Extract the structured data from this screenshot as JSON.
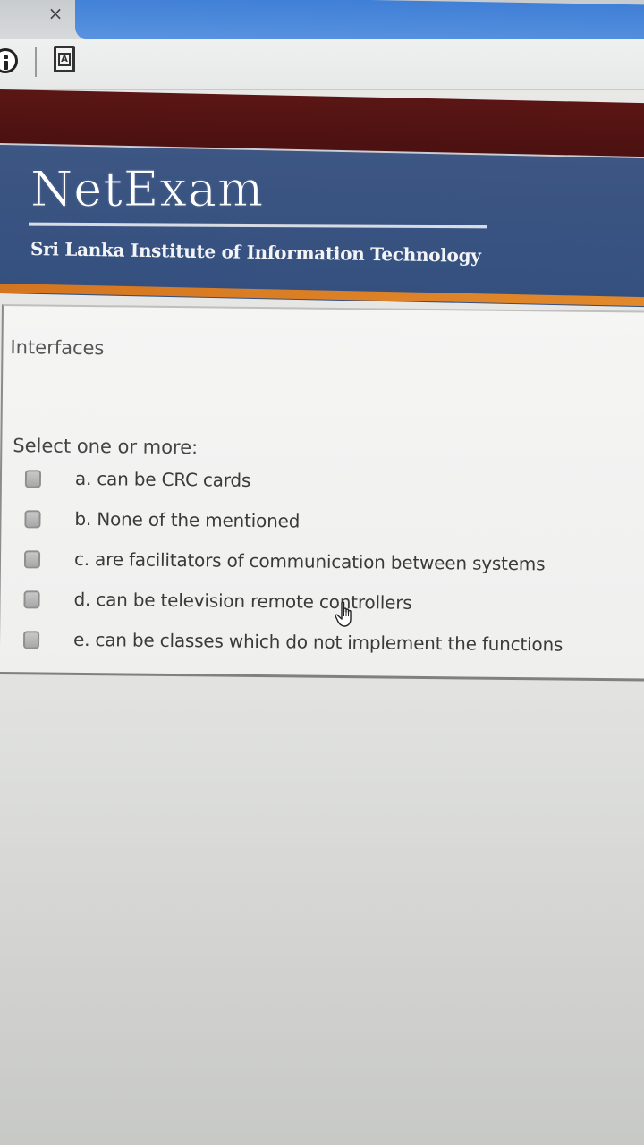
{
  "browser": {
    "close_tab_glyph": "×",
    "icons": [
      "info-icon",
      "page-icon"
    ],
    "page_icon_letter": "A"
  },
  "site": {
    "logo": "NetExam",
    "tagline": "Sri Lanka Institute of Information Technology",
    "colors": {
      "header": "#3d5683",
      "top_band": "#5a1614",
      "accent": "#e38a2d"
    }
  },
  "question": {
    "title": "Interfaces",
    "prompt": "Select one or more:",
    "options": [
      {
        "label": "a. can be CRC cards",
        "checked": false
      },
      {
        "label": "b. None of the mentioned",
        "checked": false
      },
      {
        "label": "c. are facilitators of communication between systems",
        "checked": false
      },
      {
        "label": "d. can be television remote controllers",
        "checked": false
      },
      {
        "label": "e. can be classes which do not implement the functions",
        "checked": false
      }
    ]
  },
  "cursor": {
    "icon": "hand-pointer-icon"
  }
}
